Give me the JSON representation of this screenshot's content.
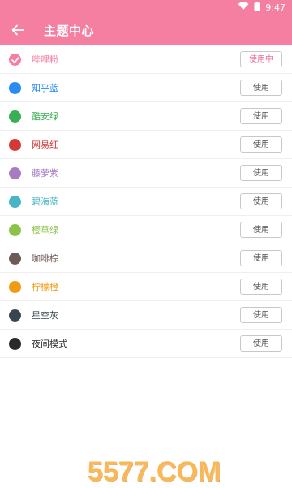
{
  "status_bar": {
    "time": "9:47"
  },
  "header": {
    "title": "主题中心"
  },
  "themes": [
    {
      "name": "哔哩粉",
      "color": "#f57fa0",
      "button": "使用中",
      "selected": true
    },
    {
      "name": "知乎蓝",
      "color": "#2a8cf0",
      "button": "使用",
      "selected": false
    },
    {
      "name": "酷安绿",
      "color": "#3aae55",
      "button": "使用",
      "selected": false
    },
    {
      "name": "网易红",
      "color": "#d23a38",
      "button": "使用",
      "selected": false
    },
    {
      "name": "藤萝紫",
      "color": "#a77cc4",
      "button": "使用",
      "selected": false
    },
    {
      "name": "碧海蓝",
      "color": "#48b4c4",
      "button": "使用",
      "selected": false
    },
    {
      "name": "樱草绿",
      "color": "#8bc34a",
      "button": "使用",
      "selected": false
    },
    {
      "name": "咖啡棕",
      "color": "#6d5c55",
      "button": "使用",
      "selected": false
    },
    {
      "name": "柠檬橙",
      "color": "#f19a13",
      "button": "使用",
      "selected": false
    },
    {
      "name": "星空灰",
      "color": "#37474f",
      "button": "使用",
      "selected": false
    },
    {
      "name": "夜间模式",
      "color": "#2a2a2a",
      "button": "使用",
      "selected": false
    }
  ],
  "watermark": "5577.COM"
}
